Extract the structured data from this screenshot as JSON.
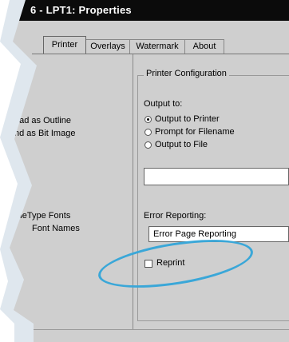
{
  "window": {
    "title": "6 - LPT1: Properties"
  },
  "tabs": [
    {
      "label": "Printer",
      "active": true
    },
    {
      "label": "Overlays",
      "active": false
    },
    {
      "label": "Watermark",
      "active": false
    },
    {
      "label": "About",
      "active": false
    }
  ],
  "left_panel": {
    "items": [
      "oad as Outline",
      "nd as Bit Image",
      "",
      "rueType Fonts",
      "Font Names"
    ]
  },
  "printer_config": {
    "group_title": "Printer Configuration",
    "output_label": "Output to:",
    "output_options": [
      {
        "label": "Output to Printer",
        "checked": true
      },
      {
        "label": "Prompt for Filename",
        "checked": false
      },
      {
        "label": "Output to File",
        "checked": false
      }
    ],
    "file_path_value": "",
    "error_reporting_label": "Error Reporting:",
    "error_reporting_value": "Error Page Reporting",
    "reprint_label": "Reprint",
    "reprint_checked": false
  },
  "colors": {
    "highlight_ellipse": "#3aa7d8",
    "titlebar": "#0b0b0b",
    "dialog_face": "#cfcfcf"
  }
}
